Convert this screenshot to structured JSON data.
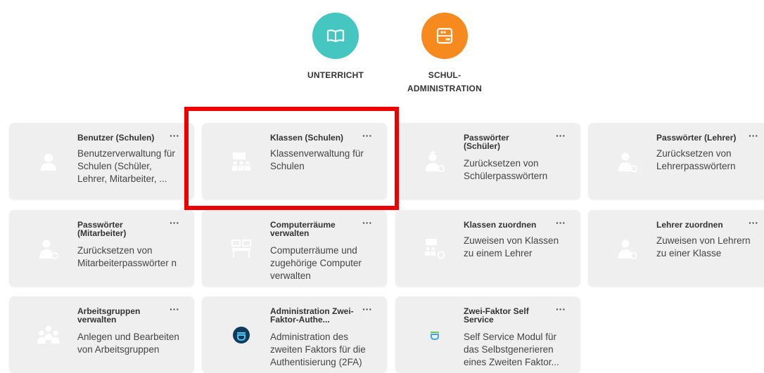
{
  "categories": [
    {
      "label": "UNTERRICHT",
      "color": "#45c6c0",
      "icon": "book-icon"
    },
    {
      "label": "SCHUL-\nADMINISTRATION",
      "color": "#f68a1f",
      "icon": "abacus-icon"
    }
  ],
  "tiles": [
    {
      "title": "Benutzer (Schulen)",
      "desc": "Benutzerverwaltung für Schulen (Schüler, Lehrer, Mitarbeiter, ...",
      "menu": "···",
      "icon": "user-icon"
    },
    {
      "title": "Klassen (Schulen)",
      "desc": "Klassenverwaltung für Schulen",
      "menu": "···",
      "icon": "classroom-icon"
    },
    {
      "title": "Passwörter (Schüler)",
      "desc": "Zurücksetzen von Schülerpasswörtern",
      "menu": "···",
      "icon": "student-key-icon"
    },
    {
      "title": "Passwörter (Lehrer)",
      "desc": "Zurücksetzen von Lehrerpasswörtern",
      "menu": "···",
      "icon": "teacher-key-icon"
    },
    {
      "title": "Passwörter (Mitarbeiter)",
      "desc": "Zurücksetzen von Mitarbeiterpasswörter n",
      "menu": "···",
      "icon": "staff-key-icon"
    },
    {
      "title": "Computerräume verwalten",
      "desc": "Computerräume und zugehörige Computer verwalten",
      "menu": "···",
      "icon": "computer-room-icon"
    },
    {
      "title": "Klassen zuordnen",
      "desc": "Zuweisen von Klassen zu einem Lehrer",
      "menu": "···",
      "icon": "assign-class-icon"
    },
    {
      "title": "Lehrer zuordnen",
      "desc": "Zuweisen von Lehrern zu einer Klasse",
      "menu": "···",
      "icon": "assign-teacher-icon"
    },
    {
      "title": "Arbeitsgruppen verwalten",
      "desc": "Anlegen und Bearbeiten von Arbeitsgruppen",
      "menu": "···",
      "icon": "workgroup-icon"
    },
    {
      "title": "Administration Zwei-Faktor-Authe...",
      "desc": "Administration des zweiten Faktors für die Authentisierung (2FA)",
      "menu": "···",
      "icon": "privacyidea-logo-icon"
    },
    {
      "title": "Zwei-Faktor Self Service",
      "desc": "Self Service Modul für das Selbstgenerieren eines Zweiten Faktor...",
      "menu": "···",
      "icon": "privacyidea-small-icon"
    }
  ]
}
